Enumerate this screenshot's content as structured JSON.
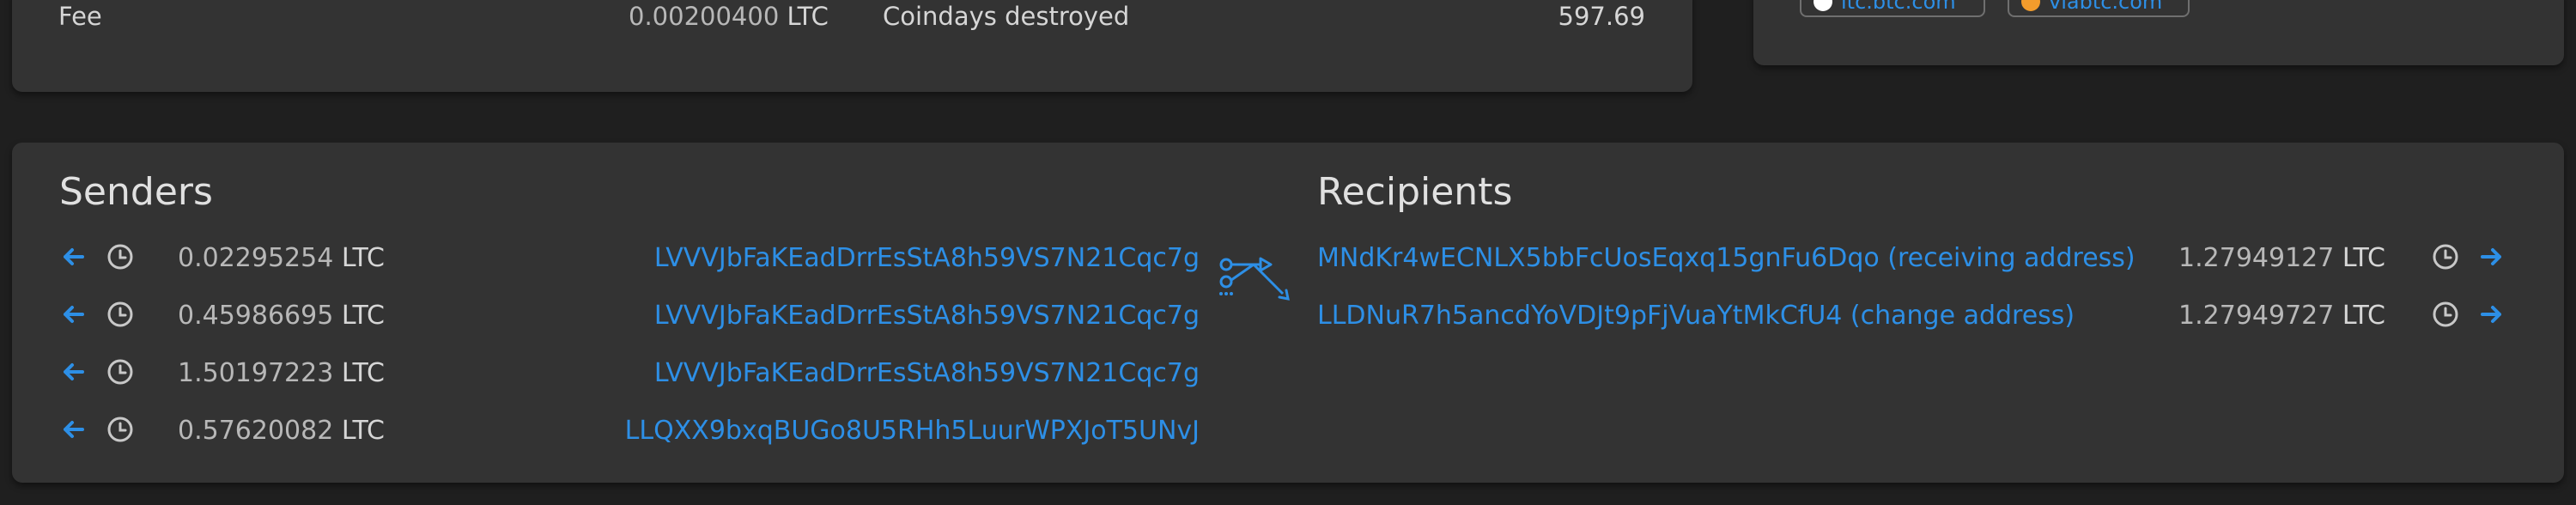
{
  "fee_row": {
    "label": "Fee",
    "value": "0.00200400",
    "unit": "LTC",
    "coindays_label": "Coindays destroyed",
    "coindays_value": "597.69"
  },
  "explorers": [
    {
      "label": "ltc.btc.com",
      "icon": "btc-com-icon"
    },
    {
      "label": "viabtc.com",
      "icon": "viabtc-icon"
    }
  ],
  "senders": {
    "title": "Senders",
    "rows": [
      {
        "amount": "0.02295254",
        "unit": "LTC",
        "address": "LVVVJbFaKEadDrrEsStA8h59VS7N21Cqc7g"
      },
      {
        "amount": "0.45986695",
        "unit": "LTC",
        "address": "LVVVJbFaKEadDrrEsStA8h59VS7N21Cqc7g"
      },
      {
        "amount": "1.50197223",
        "unit": "LTC",
        "address": "LVVVJbFaKEadDrrEsStA8h59VS7N21Cqc7g"
      },
      {
        "amount": "0.57620082",
        "unit": "LTC",
        "address": "LLQXX9bxqBUGo8U5RHh5LuurWPXJoT5UNvJ"
      }
    ]
  },
  "recipients": {
    "title": "Recipients",
    "rows": [
      {
        "address": "MNdKr4wECNLX5bbFcUosEqxq15gnFu6Dqo (receiving address)",
        "amount": "1.27949127",
        "unit": "LTC"
      },
      {
        "address": "LLDNuR7h5ancdYoVDJt9pFjVuaYtMkCfU4 (change address)",
        "amount": "1.27949727",
        "unit": "LTC"
      }
    ]
  },
  "colors": {
    "background": "#1f1f1f",
    "panel": "#333333",
    "link": "#2d8fe6",
    "text": "#d6d6d6"
  }
}
